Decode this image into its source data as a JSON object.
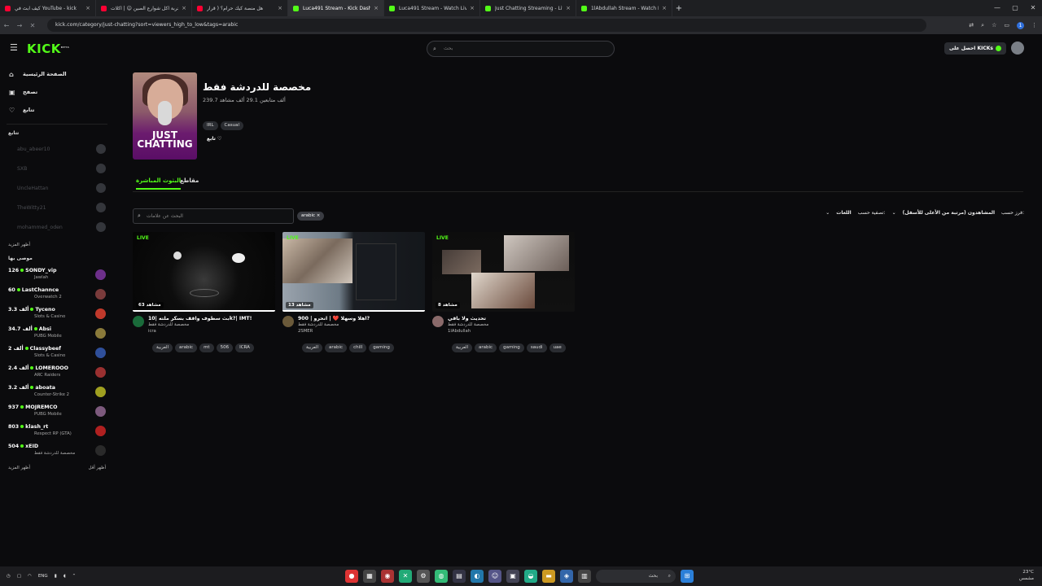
{
  "browser": {
    "tabs": [
      {
        "title": "كيف ابث في YouTube - kick",
        "color": "#ff0033",
        "active": false
      },
      {
        "title": "تجربة اكل شوارع الصين ☺ | اكلات",
        "color": "#ff0033",
        "active": false
      },
      {
        "title": "هل منصة كيك حرام؟ ( قرار",
        "color": "#ff0033",
        "active": false
      },
      {
        "title": "Luca491 Stream - Kick Dash",
        "color": "#53fc18",
        "active": true
      },
      {
        "title": "Luca491 Stream - Watch Live o",
        "color": "#53fc18",
        "active": false
      },
      {
        "title": "Just Chatting Streaming - Live S",
        "color": "#53fc18",
        "active": false
      },
      {
        "title": "1lAbdullah Stream - Watch Liv",
        "color": "#53fc18",
        "active": false
      }
    ],
    "url": "kick.com/category/just-chatting?sort=viewers_high_to_low&tags=arabic",
    "profile_initial": "1"
  },
  "header": {
    "logo": "KICK",
    "logo_beta": "BETA",
    "search_placeholder": "بحث",
    "get_kicks": "احصل على KICKs"
  },
  "sidebar": {
    "nav": [
      {
        "icon": "⌂",
        "label": "الصفحة الرئيسية"
      },
      {
        "icon": "▣",
        "label": "تصفح"
      },
      {
        "icon": "♡",
        "label": "تتابع"
      }
    ],
    "following_title": "تتابع",
    "following": [
      "abu_abeer10",
      "SXB",
      "UncleHattan",
      "TheWitty21",
      "mohammed_oden"
    ],
    "show_more": "أظهر المزيد",
    "recommended_title": "موصى بها",
    "recommended": [
      {
        "count": "126",
        "name": "SONDY_vip",
        "category": "Jawlah",
        "color": "#6d2f8a"
      },
      {
        "count": "60",
        "name": "LastChannce",
        "category": "Overwatch 2",
        "color": "#7a3b3b"
      },
      {
        "count": "3.3 ألف",
        "name": "Tyceno",
        "category": "Slots & Casino",
        "color": "#c0392b"
      },
      {
        "count": "34.7 ألف",
        "name": "Absi",
        "category": "PUBG Mobile",
        "color": "#8a7a3a"
      },
      {
        "count": "2 ألف",
        "name": "Classybeef",
        "category": "Slots & Casino",
        "color": "#2f4f9a"
      },
      {
        "count": "2.4 ألف",
        "name": "LOMEROOO",
        "category": "ARC Raiders",
        "color": "#9a3030"
      },
      {
        "count": "3.2 ألف",
        "name": "aboata",
        "category": "Counter-Strike 2",
        "color": "#a0a020"
      },
      {
        "count": "937",
        "name": "MOJREMCO",
        "category": "PUBG Mobile",
        "color": "#7d5a7d"
      },
      {
        "count": "803",
        "name": "klash_rt",
        "category": "Respect RP (GTA)",
        "color": "#b02020"
      },
      {
        "count": "504",
        "name": "xEID",
        "category": "مخصصة للدردشة فقط",
        "color": "#2a2a2a"
      }
    ],
    "footer_more": "أظهر المزيد",
    "footer_less": "أظهر أقل"
  },
  "category": {
    "image_text": "JUST CHATTING",
    "title": "مخصصة للدردشة فقط",
    "stats": "239.7 ألف متابعين   29.1 ألف مشاهد",
    "tags": [
      "IRL",
      "Casual"
    ],
    "follow_label": "تابع"
  },
  "tabs": {
    "live": "البثوث المباشرة",
    "clips": "مقاطع"
  },
  "filters": {
    "tag_search_placeholder": "البحث عن علامات",
    "active_tag": "arabic ×",
    "sort_label": "فرز حسب:",
    "sort_value": "المشاهدون (مرتبة من الأعلى للأسفل)",
    "filter_label": "تصفية حسب:",
    "filter_value": "اللغات"
  },
  "streams": [
    {
      "live": "LIVE",
      "viewers": "63 مشاهد",
      "title": "بث سطوف واقف بسكر ملته |10k?| IMT!",
      "category": "مخصصة للدردشة فقط",
      "streamer": "icra",
      "tags": [
        "العربية",
        "arabic",
        "mt",
        "506",
        "ICRA"
      ],
      "avatar_color": "#1a6b3a"
    },
    {
      "live": "LIVE",
      "viewers": "13 مشاهد",
      "title": "اهلا وسهلا ❤️ | انحرو | 900?",
      "category": "مخصصة للدردشة فقط",
      "streamer": "2SMER",
      "tags": [
        "العربية",
        "arabic",
        "chill",
        "gaming"
      ],
      "avatar_color": "#6b5a3a"
    },
    {
      "live": "LIVE",
      "viewers": "8 مشاهد",
      "title": "تحديث ولا باقي",
      "category": "مخصصة للدردشة فقط",
      "streamer": "1lAbdullah",
      "tags": [
        "العربية",
        "arabic",
        "gaming",
        "saudi",
        "uae"
      ],
      "avatar_color": "#8a6a6a"
    }
  ],
  "taskbar": {
    "lang": "ENG",
    "search": "بحث",
    "weather": "23°C",
    "weather_desc": "مشمس"
  }
}
